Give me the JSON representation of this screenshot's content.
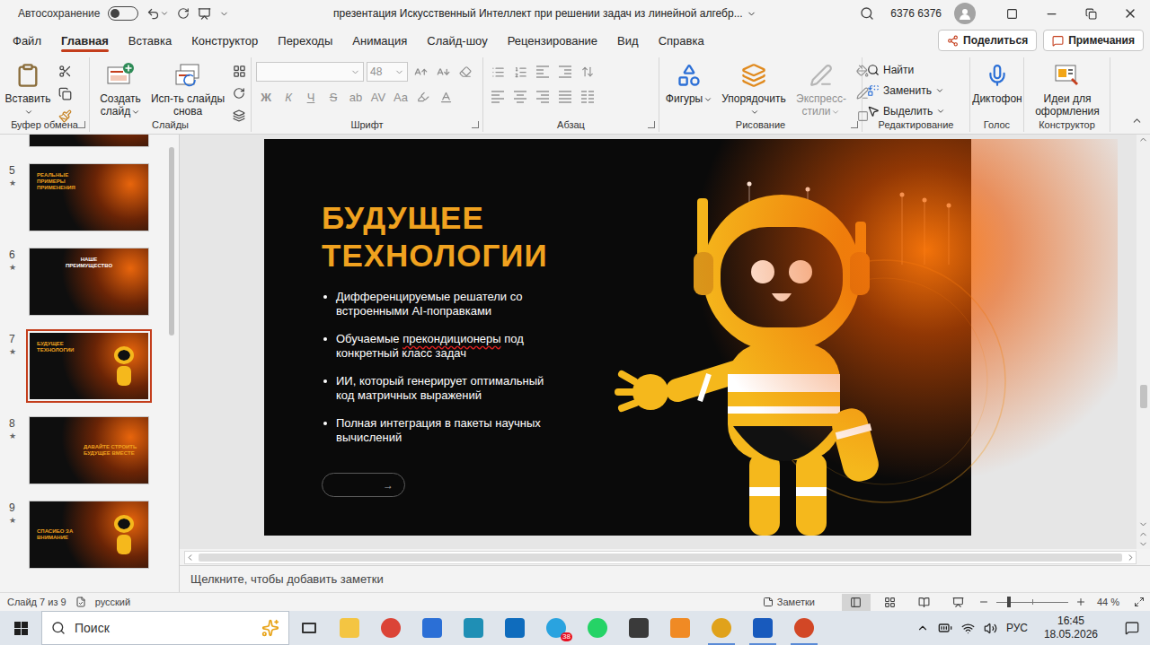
{
  "window": {
    "title": "презентация Искусственный Интеллект при решении задач из линейной алгебр...",
    "autosave": {
      "label": "Автосохранение",
      "on": false
    },
    "user": "6376 6376"
  },
  "tabs": [
    {
      "label": "Файл",
      "selected": false
    },
    {
      "label": "Главная",
      "selected": true
    },
    {
      "label": "Вставка",
      "selected": false
    },
    {
      "label": "Конструктор",
      "selected": false
    },
    {
      "label": "Переходы",
      "selected": false
    },
    {
      "label": "Анимация",
      "selected": false
    },
    {
      "label": "Слайд-шоу",
      "selected": false
    },
    {
      "label": "Рецензирование",
      "selected": false
    },
    {
      "label": "Вид",
      "selected": false
    },
    {
      "label": "Справка",
      "selected": false
    }
  ],
  "actions": {
    "share": "Поделиться",
    "comments": "Примечания"
  },
  "ribbon": {
    "clipboard": {
      "label": "Буфер обмена",
      "paste": "Вставить"
    },
    "slides": {
      "label": "Слайды",
      "new_slide": "Создать слайд",
      "reuse": "Исп-ть слайды снова"
    },
    "font": {
      "label": "Шрифт",
      "size": "48",
      "disabled": true,
      "styles": [
        "Ж",
        "К",
        "Ч",
        "S",
        "ab",
        "AV",
        "Aa"
      ]
    },
    "paragraph": {
      "label": "Абзац",
      "disabled": true
    },
    "drawing": {
      "label": "Рисование",
      "shapes": "Фигуры",
      "arrange": "Упорядочить",
      "quick_styles": "Экспресс-стили",
      "quick_styles_disabled": true
    },
    "editing": {
      "label": "Редактирование",
      "find": "Найти",
      "replace": "Заменить",
      "select": "Выделить"
    },
    "voice": {
      "label": "Голос",
      "dictate": "Диктофон"
    },
    "designer": {
      "label": "Конструктор",
      "ideas": "Идеи для оформления"
    }
  },
  "slides_panel": {
    "mark": "★",
    "items": [
      {
        "number": "5",
        "title": "РЕАЛЬНЫЕ ПРИМЕРЫ ПРИМЕНЕНИЯ",
        "kind": "left",
        "selected": false
      },
      {
        "number": "6",
        "title": "НАШЕ ПРЕИМУЩЕСТВО",
        "kind": "center",
        "selected": false
      },
      {
        "number": "7",
        "title": "БУДУЩЕЕ ТЕХНОЛОГИИ",
        "kind": "robot",
        "selected": true
      },
      {
        "number": "8",
        "title": "ДАВАЙТЕ СТРОИТЬ БУДУЩЕЕ ВМЕСТЕ",
        "kind": "right",
        "selected": false
      },
      {
        "number": "9",
        "title": "СПАСИБО ЗА ВНИМАНИЕ",
        "kind": "robot-middle",
        "selected": false
      }
    ]
  },
  "slide": {
    "title": [
      "БУДУЩЕЕ",
      "ТЕХНОЛОГИИ"
    ],
    "bullets": [
      [
        {
          "text": "Дифференцируемые решатели со встроенными AI-поправками",
          "misspelled": false
        }
      ],
      [
        {
          "text": "Обучаемые ",
          "misspelled": false
        },
        {
          "text": "прекондиционеры",
          "misspelled": true
        },
        {
          "text": " под конкретный класс задач",
          "misspelled": false
        }
      ],
      [
        {
          "text": "ИИ, который генерирует оптимальный код матричных выражений",
          "misspelled": false
        }
      ],
      [
        {
          "text": "Полная интеграция в пакеты научных вычислений",
          "misspelled": false
        }
      ]
    ],
    "button": "→"
  },
  "notes": {
    "placeholder": "Щелкните, чтобы добавить заметки"
  },
  "status_bar": {
    "slide": "Слайд 7 из 9",
    "language": "русский",
    "notes": "Заметки",
    "views": [
      {
        "kind": "normal",
        "selected": true
      },
      {
        "kind": "sorter",
        "selected": false
      },
      {
        "kind": "reading",
        "selected": false
      },
      {
        "kind": "slideshow",
        "selected": false
      }
    ],
    "zoom": "44 %",
    "zoom_level": 0.17
  },
  "taskbar": {
    "search": "Поиск",
    "apps": [
      {
        "kind": "square",
        "color": "#f4c542",
        "open": false,
        "badge": ""
      },
      {
        "kind": "circle",
        "color": "#db4437",
        "open": false,
        "badge": ""
      },
      {
        "kind": "square",
        "color": "#2b6fd6",
        "open": false,
        "badge": ""
      },
      {
        "kind": "square",
        "color": "#1f8fb5",
        "open": false,
        "badge": ""
      },
      {
        "kind": "square",
        "color": "#0f6cbd",
        "open": false,
        "badge": ""
      },
      {
        "kind": "circle",
        "color": "#2aa3df",
        "open": false,
        "badge": "38"
      },
      {
        "kind": "circle",
        "color": "#25d366",
        "open": false,
        "badge": ""
      },
      {
        "kind": "square",
        "color": "#3a3a3a",
        "open": false,
        "badge": ""
      },
      {
        "kind": "square",
        "color": "#f08a24",
        "open": false,
        "badge": ""
      },
      {
        "kind": "circle",
        "color": "#e0a21b",
        "open": true,
        "badge": ""
      },
      {
        "kind": "square",
        "color": "#185abd",
        "open": true,
        "badge": ""
      },
      {
        "kind": "circle",
        "color": "#d24726",
        "open": true,
        "badge": ""
      }
    ],
    "tray": {
      "language": "РУС",
      "time": "16:45",
      "date": "18.05.2026"
    }
  }
}
